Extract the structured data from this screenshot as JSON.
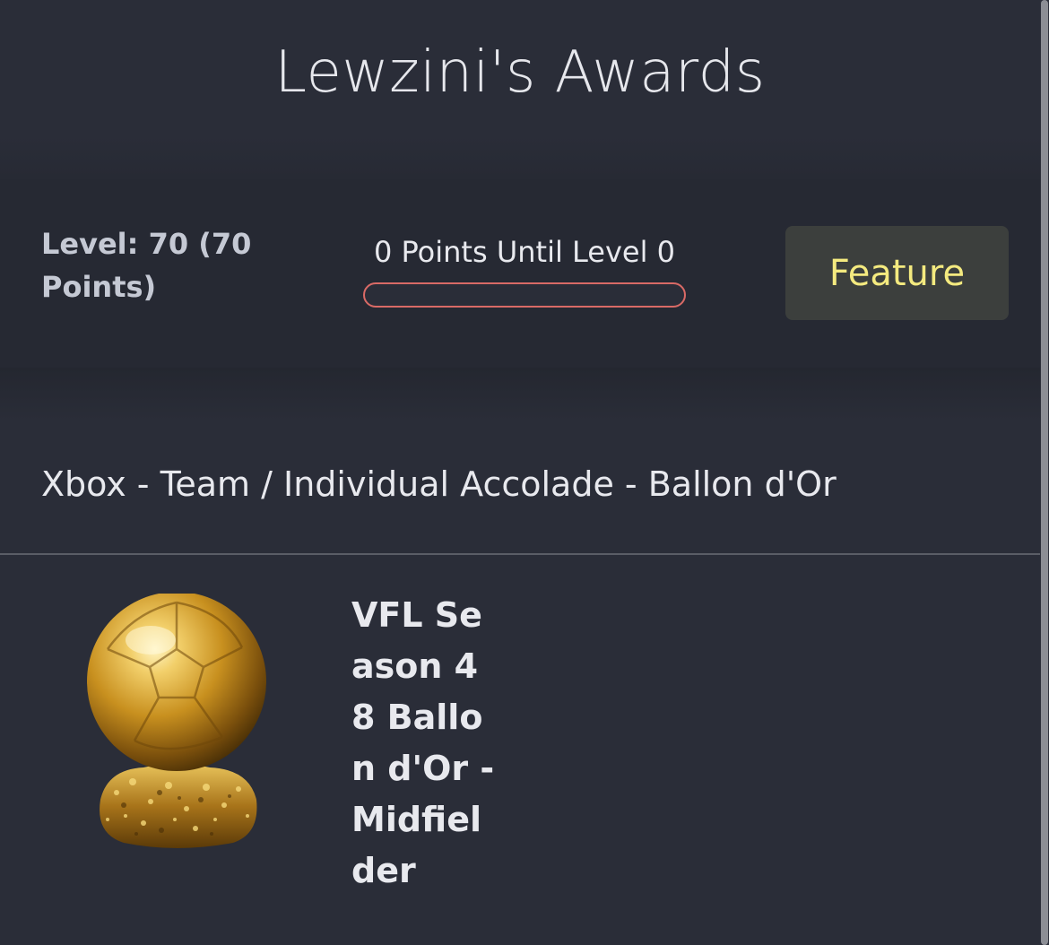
{
  "header": {
    "title": "Lewzini's Awards"
  },
  "level_panel": {
    "level_text": "Level: 70 (70 Points)",
    "points_until_text": "0 Points Until Level 0",
    "progress_fraction": 0,
    "feature_label": "Feature"
  },
  "awards_section": {
    "category_heading": "Xbox - Team / Individual Accolade - Ballon d'Or",
    "awards": [
      {
        "title": "VFL Season 48 Ballon d'Or - Midfielder",
        "image": "ballon-d-or-trophy"
      }
    ]
  },
  "colors": {
    "background": "#2a2d38",
    "panel": "#262933",
    "progress_border": "#d96a66",
    "feature_text": "#f4ea7f",
    "feature_bg": "#3c3f3d"
  }
}
